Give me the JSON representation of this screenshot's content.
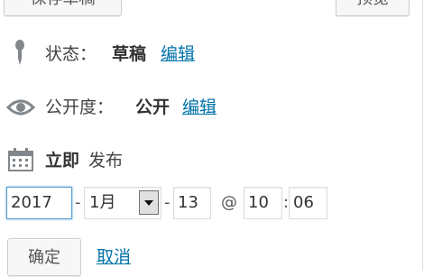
{
  "buttons": {
    "save_draft": "保存草稿",
    "preview": "预览",
    "confirm": "确定"
  },
  "status": {
    "label": "状态：",
    "value": "草稿",
    "edit": "编辑",
    "icon": "pin-icon"
  },
  "visibility": {
    "label": "公开度：",
    "value": "公开",
    "edit": "编辑",
    "icon": "eye-icon"
  },
  "publish": {
    "emphasis": "立即",
    "label": "发布",
    "icon": "calendar-icon"
  },
  "date": {
    "year": "2017",
    "month": "1月",
    "day": "13",
    "hour": "10",
    "minute": "06",
    "sep_dash": "-",
    "sep_at": "@",
    "sep_colon": ":"
  },
  "cancel": "取消",
  "colors": {
    "link": "#0073aa",
    "focus_border": "#5b9dd9"
  }
}
